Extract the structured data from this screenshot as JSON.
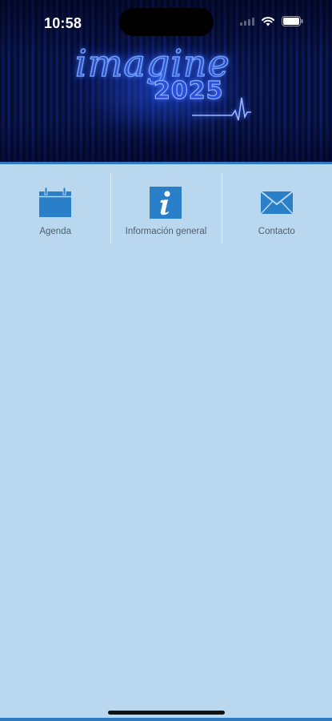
{
  "status_bar": {
    "time": "10:58",
    "icons": [
      "signal-icon",
      "wifi-icon",
      "battery-icon"
    ]
  },
  "header": {
    "logo_word": "imagine",
    "logo_year": "2025",
    "logo_icon": "heartbeat-line-icon"
  },
  "menu": {
    "items": [
      {
        "label": "Agenda",
        "icon": "calendar-icon"
      },
      {
        "label": "Información general",
        "icon": "info-icon"
      },
      {
        "label": "Contacto",
        "icon": "envelope-icon"
      }
    ]
  },
  "colors": {
    "background": "#b9d8ef",
    "accent": "#2f7bc2",
    "icon_blue": "#2a7fc9",
    "label_text": "#4d6070",
    "header_dark": "#040a28"
  }
}
